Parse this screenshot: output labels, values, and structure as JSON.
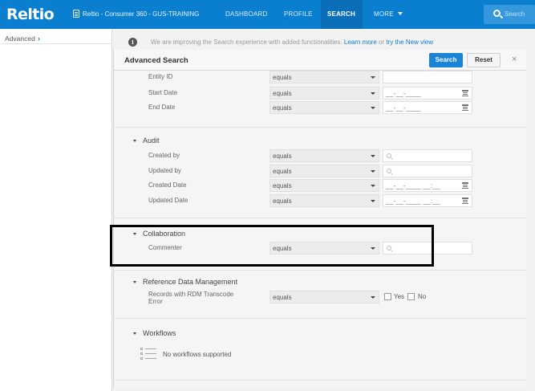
{
  "header": {
    "logo": "Reltio",
    "tenant": "Reltio - Consumer 360 - GUS-TRAINING",
    "nav": [
      "DASHBOARD",
      "PROFILE",
      "SEARCH",
      "MORE"
    ],
    "active_nav": "SEARCH",
    "search_placeholder": "Search"
  },
  "sidebar": {
    "items": [
      {
        "label": "Advanced",
        "chevron": "›"
      }
    ]
  },
  "infobar": {
    "icon": "info-icon",
    "text": "We are improving the Search experience with added functionalities.",
    "link1": "Learn more",
    "or": "or",
    "link2": "try the New view"
  },
  "panel": {
    "title": "Advanced Search",
    "search_button": "Search",
    "reset_button": "Reset",
    "close": "×"
  },
  "general_rows": [
    {
      "label": "Entity ID",
      "operator": "equals",
      "value": "",
      "type": "text"
    },
    {
      "label": "Start Date",
      "operator": "equals",
      "value": "__-__-____",
      "type": "date"
    },
    {
      "label": "End Date",
      "operator": "equals",
      "value": "__-__-____",
      "type": "date"
    }
  ],
  "audit": {
    "title": "Audit",
    "rows": [
      {
        "label": "Created by",
        "operator": "equals",
        "value": "",
        "type": "search"
      },
      {
        "label": "Updated by",
        "operator": "equals",
        "value": "",
        "type": "search"
      },
      {
        "label": "Created Date",
        "operator": "equals",
        "value": "__-__-____ __:__",
        "type": "date"
      },
      {
        "label": "Updated Date",
        "operator": "equals",
        "value": "__-__-____ __:__",
        "type": "date"
      }
    ]
  },
  "collaboration": {
    "title": "Collaboration",
    "rows": [
      {
        "label": "Commenter",
        "operator": "equals",
        "value": "",
        "type": "search"
      }
    ]
  },
  "rdm": {
    "title": "Reference Data Management",
    "rows": [
      {
        "label_line1": "Records with RDM Transcode",
        "label_line2": "Error",
        "operator": "equals",
        "yes": "Yes",
        "no": "No"
      }
    ]
  },
  "workflows": {
    "title": "Workflows",
    "empty_text": "No workflows supported"
  },
  "colors": {
    "brand": "#0a7fd0",
    "button": "#1a85d6",
    "highlight": "#000000"
  }
}
